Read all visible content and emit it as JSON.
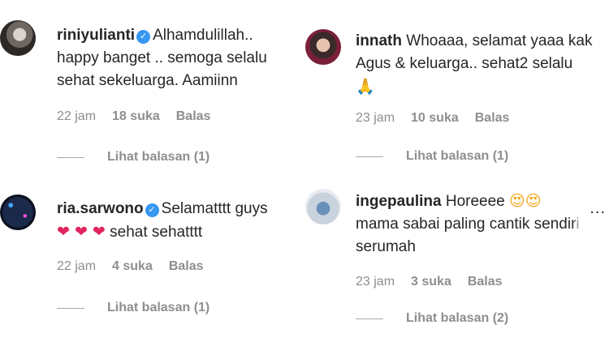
{
  "comments": [
    {
      "username": "riniyulianti",
      "text_line1": "Alhamdulillah..",
      "text_line2": "happy banget .. semoga selalu",
      "text_line3": "sehat sekeluarga. Aamiinn",
      "time": "22 jam",
      "likes": "18 suka",
      "reply": "Balas",
      "view_replies": "Lihat balasan (1)"
    },
    {
      "username": "innath",
      "text_line1": "Whoaaa, selamat yaaa kak",
      "text_line2": "Agus & keluarga.. sehat2 selalu",
      "emoji": "🙏",
      "time": "23 jam",
      "likes": "10 suka",
      "reply": "Balas",
      "view_replies": "Lihat balasan (1)"
    },
    {
      "username": "ria.sarwono",
      "text_line1": "Selamatttt guys",
      "hearts": "❤ ❤ ❤",
      "text_line2": "sehat sehatttt",
      "time": "22 jam",
      "likes": "4 suka",
      "reply": "Balas",
      "view_replies": "Lihat balasan (1)"
    },
    {
      "username": "ingepaulina",
      "text_line1": "Horeeee",
      "emoji": "😍😍",
      "text_line2a": "mama sabai paling cantik send",
      "text_line2b": "iri",
      "text_line3": "serumah",
      "time": "23 jam",
      "likes": "3 suka",
      "reply": "Balas",
      "view_replies": "Lihat balasan (2)",
      "more": "..."
    }
  ],
  "icons": {
    "verified": "verified-badge-icon",
    "more": "more-options-icon"
  },
  "colors": {
    "text": "#262626",
    "meta": "#8e8e8e",
    "verified": "#3897f0",
    "heart": "#e0245e"
  }
}
